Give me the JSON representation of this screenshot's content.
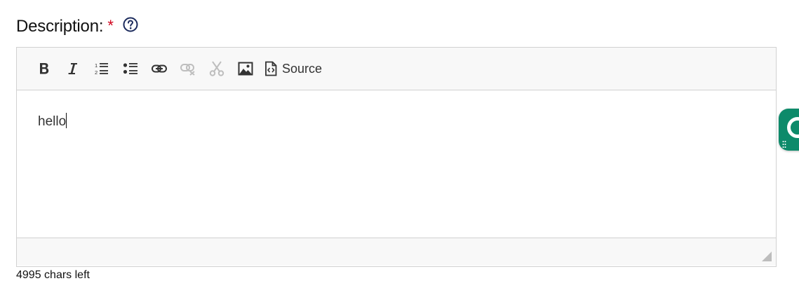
{
  "field": {
    "label": "Description:",
    "required_marker": "*",
    "help_icon": "question-circle-icon"
  },
  "toolbar": {
    "buttons": [
      {
        "icon": "bold-icon",
        "enabled": true
      },
      {
        "icon": "italic-icon",
        "enabled": true
      },
      {
        "icon": "numbered-list-icon",
        "enabled": true
      },
      {
        "icon": "bulleted-list-icon",
        "enabled": true
      },
      {
        "icon": "link-icon",
        "enabled": true
      },
      {
        "icon": "unlink-icon",
        "enabled": false
      },
      {
        "icon": "cut-icon",
        "enabled": false
      },
      {
        "icon": "image-icon",
        "enabled": true
      }
    ],
    "source_label": "Source",
    "source_icon": "source-code-icon"
  },
  "editor": {
    "content": "hello"
  },
  "counter": {
    "text": "4995 chars left"
  },
  "side_widget": {
    "icon": "assistant-widget-icon",
    "color": "#0d8a6a"
  },
  "colors": {
    "required": "#d0021b",
    "help_icon": "#1b2a5c",
    "toolbar_bg": "#f8f8f8",
    "border": "#d1d1d1"
  }
}
